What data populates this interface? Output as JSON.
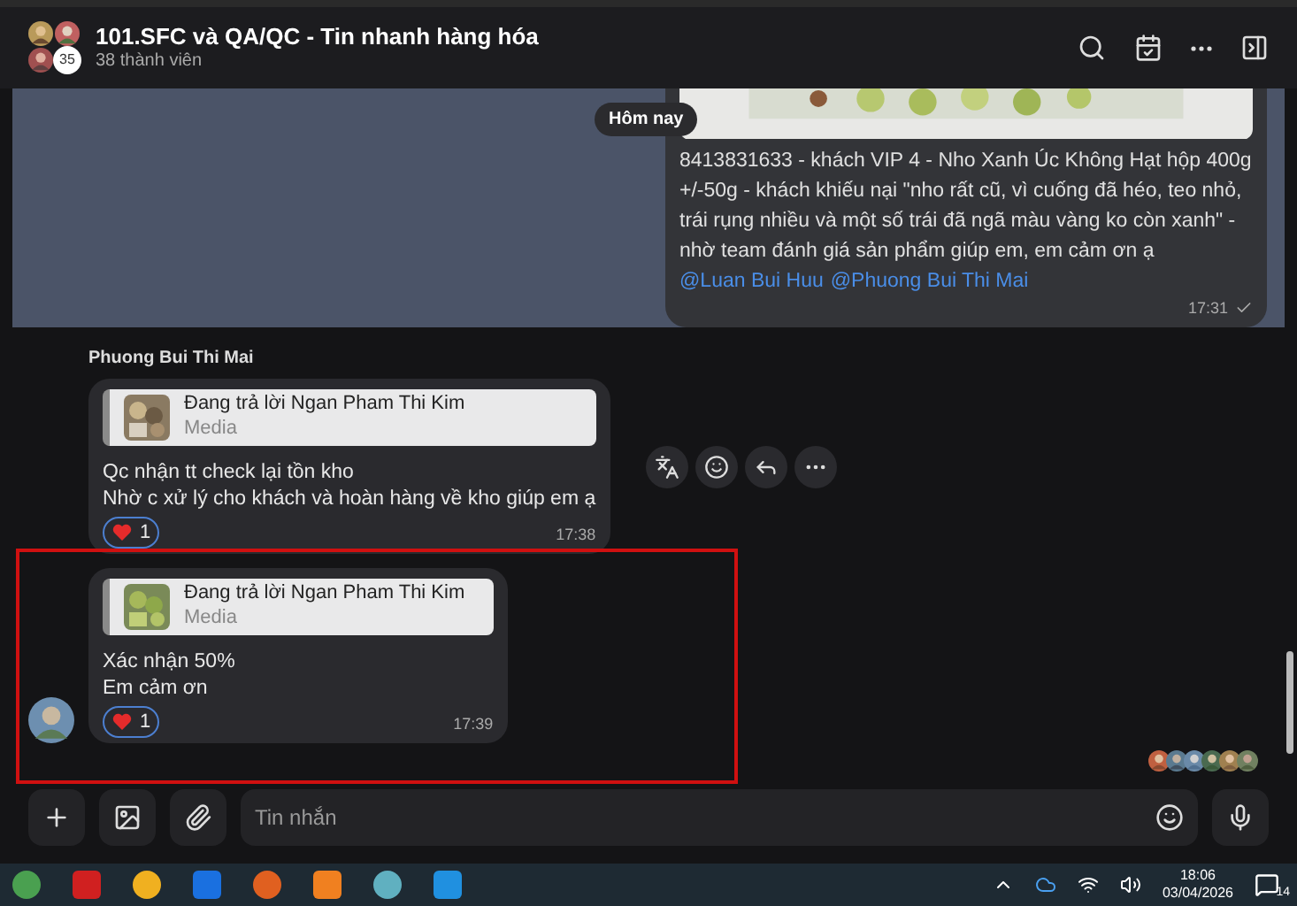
{
  "header": {
    "title": "101.SFC và QA/QC - Tin nhanh hàng hóa",
    "subtitle": "38 thành viên",
    "member_badge": "35"
  },
  "date_pill": "Hôm nay",
  "pinned_message": {
    "text": "8413831633 - khách VIP 4 - Nho Xanh Úc Không Hạt hộp 400g +/-50g - khách khiếu nại \"nho rất cũ, vì cuống đã héo, teo nhỏ, trái rụng nhiều và một số trái đã ngã màu vàng ko còn xanh\" - nhờ team đánh giá sản phẩm giúp em, em cảm ơn ạ ",
    "mentions": [
      "@Luan Bui Huu",
      "@Phuong Bui Thi Mai"
    ],
    "time": "17:31",
    "selected": true
  },
  "sender": "Phuong Bui Thi Mai",
  "messages": [
    {
      "reply_to": "Đang trả lời Ngan Pham Thi Kim",
      "reply_kind": "Media",
      "lines": [
        "Qc nhận tt check lại tồn kho",
        "Nhờ c xử lý cho khách và hoàn hàng về kho giúp em ạ"
      ],
      "reaction_count": "1",
      "time": "17:38",
      "show_avatar": false,
      "hovered": true
    },
    {
      "reply_to": "Đang trả lời Ngan Pham Thi Kim",
      "reply_kind": "Media",
      "lines": [
        "Xác nhận 50%",
        "Em cảm ơn"
      ],
      "reaction_count": "1",
      "time": "17:39",
      "show_avatar": true,
      "hovered": false
    }
  ],
  "composer": {
    "placeholder": "Tin nhắn"
  },
  "taskbar": {
    "time": "18:06",
    "date": "03/04/2026",
    "notification_count": "14"
  }
}
